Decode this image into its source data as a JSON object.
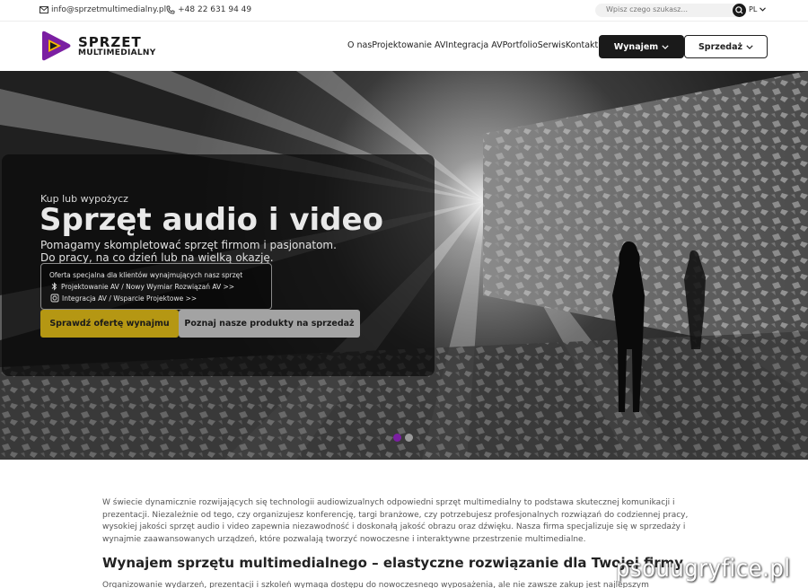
{
  "topbar": {
    "email": "info@sprzetmultimedialny.pl",
    "phone": "+48 22 631 94 49",
    "search_placeholder": "Wpisz czego szukasz...",
    "language": "PL"
  },
  "header": {
    "brand_line1": "SPRZET",
    "brand_line2": "MULTIMEDIALNY",
    "nav": [
      "O nas",
      "Projektowanie AV",
      "Integracja AV",
      "Portfolio",
      "Serwis",
      "Kontakt"
    ],
    "rent_button": "Wynajem",
    "sale_button": "Sprzedaż",
    "logo_color": "#7b1fa2",
    "logo_accent": "#f5b800"
  },
  "hero": {
    "kicker": "Kup lub wypożycz",
    "headline": "Sprzęt audio i video",
    "sub1": "Pomagamy skompletować sprzęt firmom i pasjonatom.",
    "sub2": "Do pracy, na co dzień lub na wielką okazję.",
    "offer_title": "Oferta specjalna dla klientów wynajmujących nasz sprzęt",
    "offer_link1": "Projektowanie AV / Nowy Wymiar Rozwiązań AV >>",
    "offer_link2": "Integracja AV / Wsparcie Projektowe >>",
    "cta_primary": "Sprawdź ofertę wynajmu",
    "cta_secondary": "Poznaj nasze produkty na sprzedaż",
    "primary_color": "#b59713",
    "slide_count": 2,
    "active_slide": 1
  },
  "content": {
    "paragraph": "W świecie dynamicznie rozwijających się technologii audiowizualnych odpowiedni sprzęt multimedialny to podstawa skutecznej komunikacji i prezentacji. Niezależnie od tego, czy organizujesz konferencję, targi branżowe, czy potrzebujesz profesjonalnych rozwiązań do codziennej pracy, wysokiej jakości sprzęt audio i video zapewnia niezawodność i doskonałą jakość obrazu oraz dźwięku. Nasza firma specjalizuje się w sprzedaży i wynajmie zaawansowanych urządzeń, które pozwalają tworzyć nowoczesne i interaktywne przestrzenie multimedialne.",
    "heading": "Wynajem sprzętu multimedialnego – elastyczne rozwiązanie dla Twojej firmy",
    "paragraph2": "Organizowanie wydarzeń, prezentacji i szkoleń wymaga dostępu do nowoczesnego wyposażenia, ale nie zawsze zakup jest najlepszym"
  },
  "watermark": "psouugryfice.pl"
}
